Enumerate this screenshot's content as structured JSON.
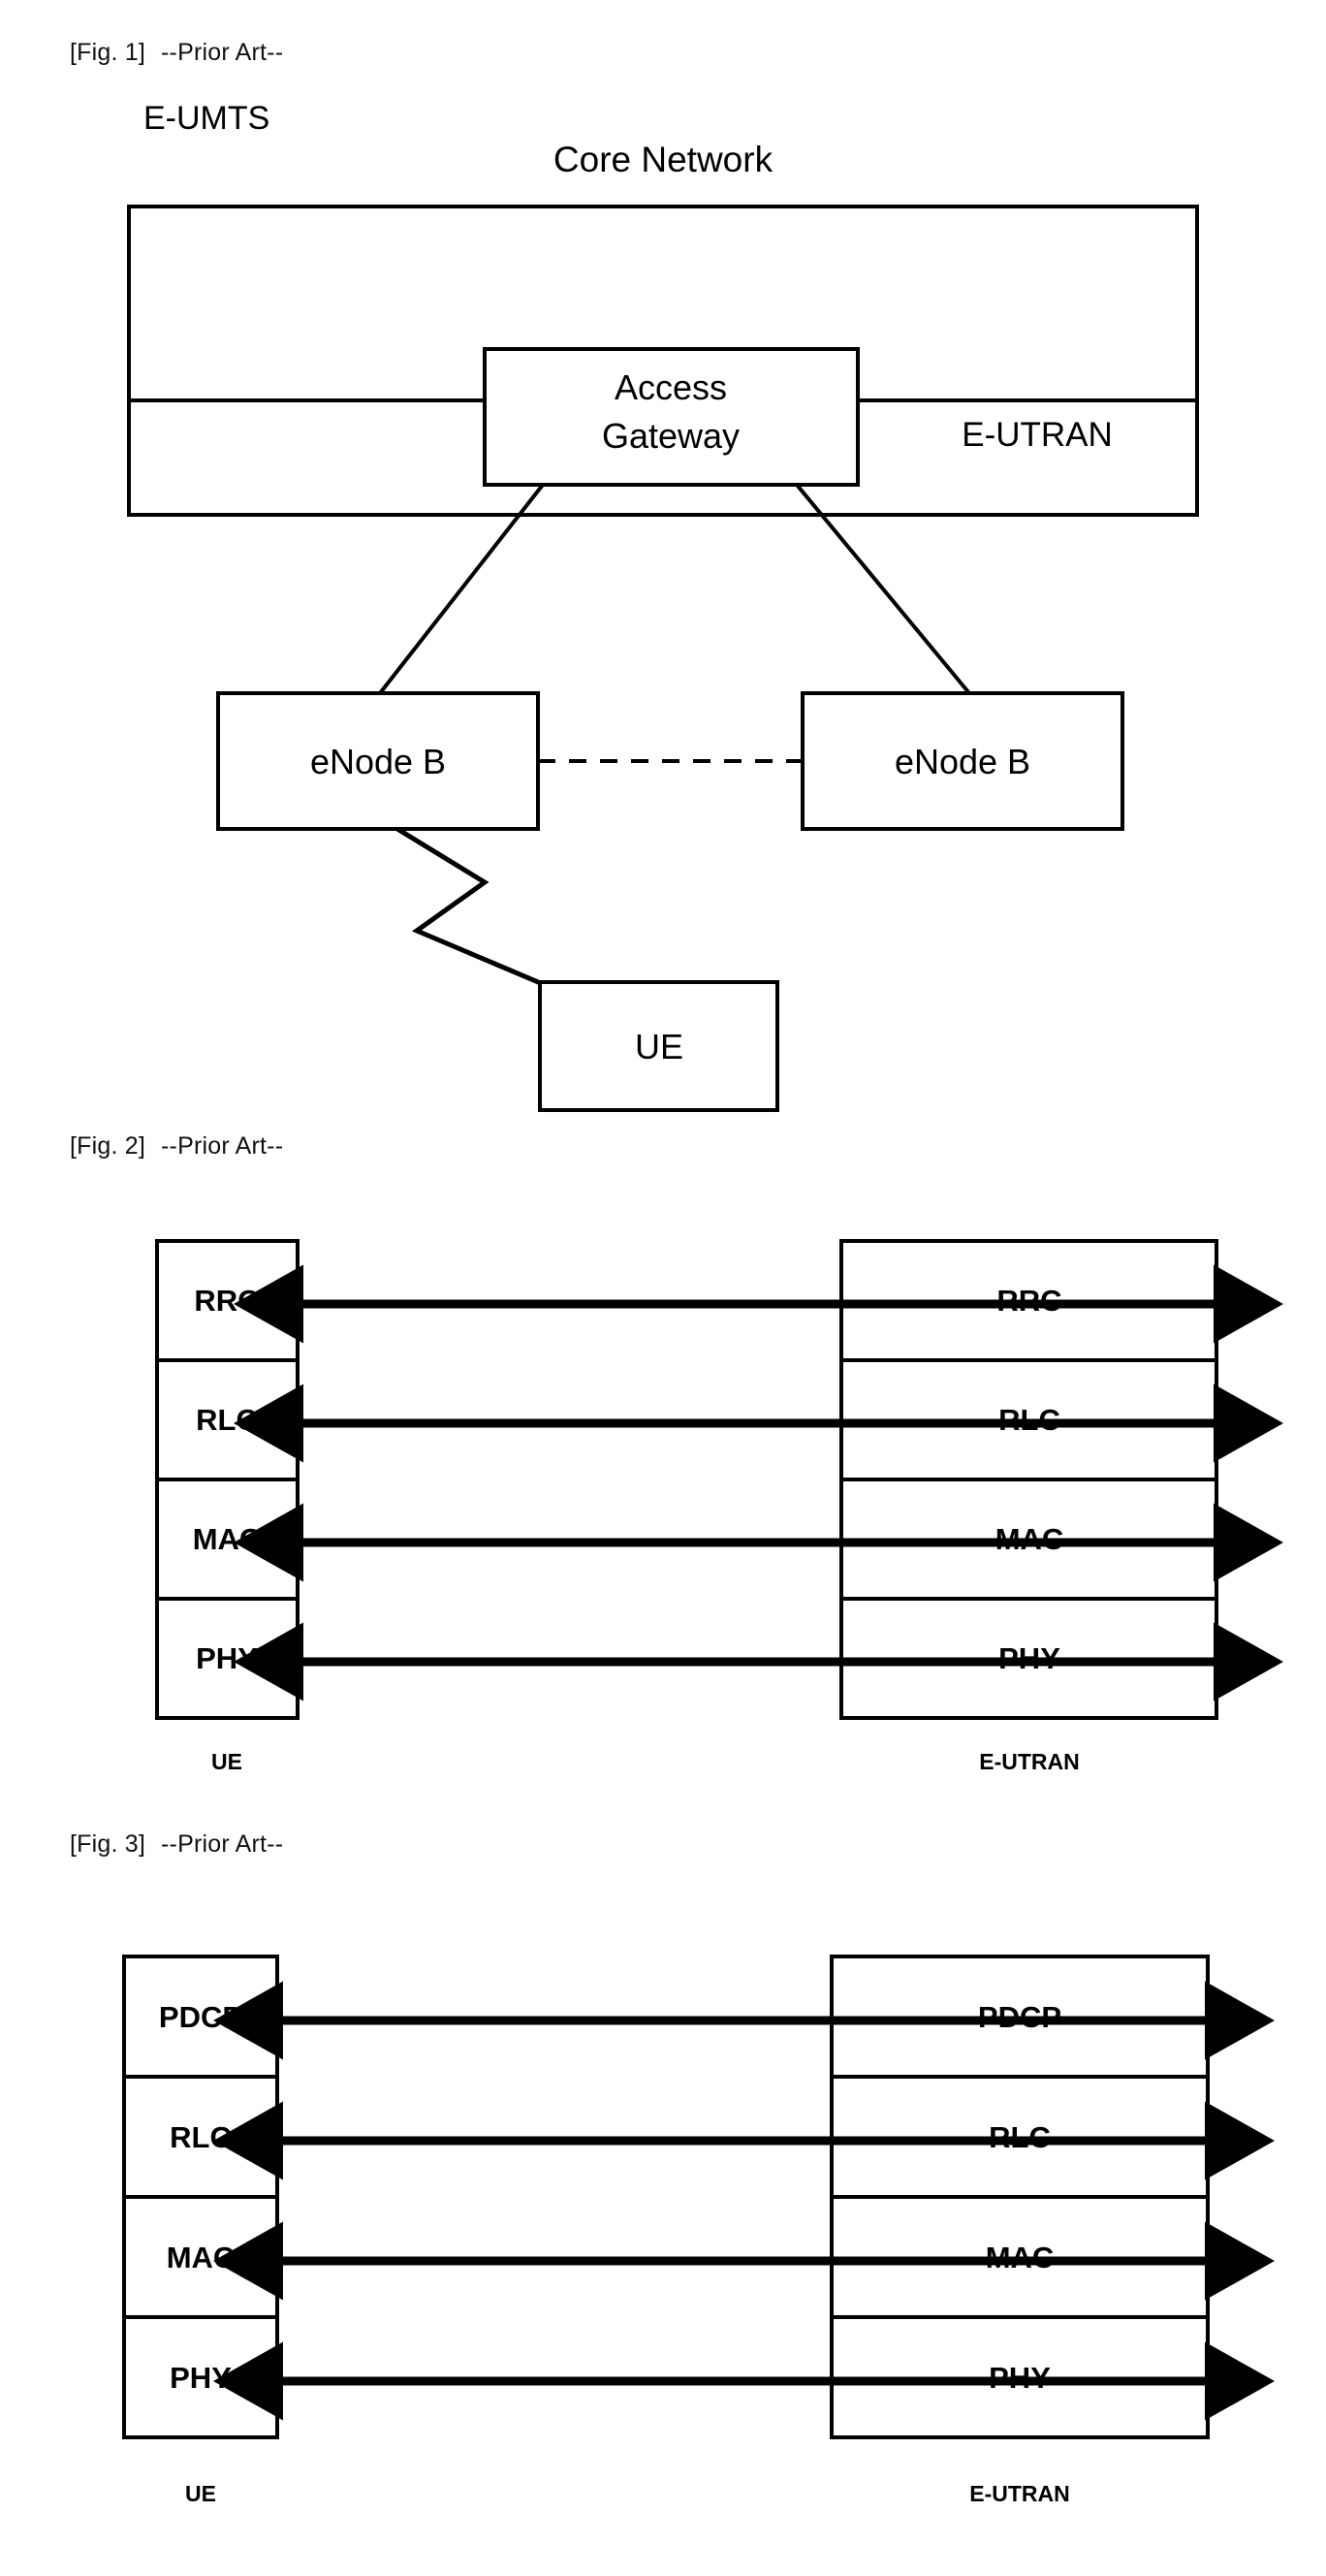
{
  "figures": [
    {
      "id": "fig1",
      "caption_number": "[Fig. 1]",
      "caption_note": "--Prior Art--",
      "outer_label": "E-UMTS",
      "core_network_label": "Core Network",
      "access_gateway_label_line1": "Access",
      "access_gateway_label_line2": "Gateway",
      "eutran_label": "E-UTRAN",
      "enodeb_left_label": "eNode B",
      "enodeb_right_label": "eNode B",
      "ue_label": "UE"
    },
    {
      "id": "fig2",
      "caption_number": "[Fig. 2]",
      "caption_note": "--Prior Art--",
      "left_endpoint_label": "UE",
      "right_endpoint_label": "E-UTRAN",
      "layers": [
        "RRC",
        "RLC",
        "MAC",
        "PHY"
      ],
      "left_layers": [
        "RRC",
        "RLC",
        "MAC",
        "PHY"
      ],
      "right_layers": [
        "RRC",
        "RLC",
        "MAC",
        "PHY"
      ]
    },
    {
      "id": "fig3",
      "caption_number": "[Fig. 3]",
      "caption_note": "--Prior Art--",
      "left_endpoint_label": "UE",
      "right_endpoint_label": "E-UTRAN",
      "layers": [
        "PDCP",
        "RLC",
        "MAC",
        "PHY"
      ],
      "left_layers": [
        "PDCP",
        "RLC",
        "MAC",
        "PHY"
      ],
      "right_layers": [
        "PDCP",
        "RLC",
        "MAC",
        "PHY"
      ]
    }
  ],
  "colors": {
    "ink": "#000000",
    "paper": "#ffffff"
  }
}
